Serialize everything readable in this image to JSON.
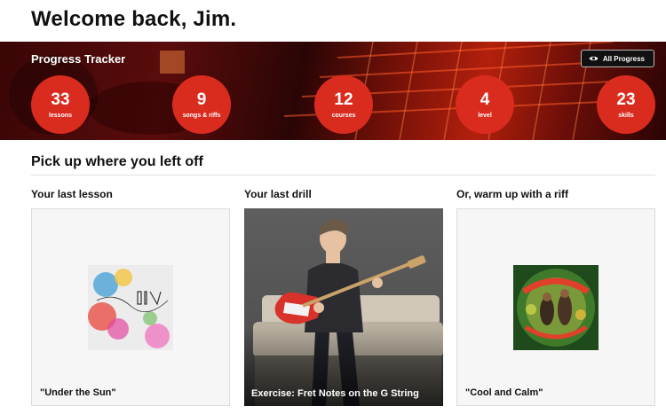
{
  "header": {
    "welcome": "Welcome back, Jim."
  },
  "progress": {
    "title": "Progress Tracker",
    "all_progress_label": "All Progress",
    "stats": [
      {
        "value": "33",
        "label": "lessons"
      },
      {
        "value": "9",
        "label": "songs & riffs"
      },
      {
        "value": "12",
        "label": "courses"
      },
      {
        "value": "4",
        "label": "level"
      },
      {
        "value": "23",
        "label": "skills"
      }
    ]
  },
  "continue": {
    "heading": "Pick up where you left off",
    "columns": [
      {
        "title": "Your last lesson",
        "card_title": "\"Under the Sun\""
      },
      {
        "title": "Your last drill",
        "card_title": "Exercise: Fret Notes on the G String"
      },
      {
        "title": "Or, warm up with a riff",
        "card_title": "\"Cool and Calm\""
      }
    ]
  },
  "colors": {
    "accent": "#d92c1f",
    "banner": "#5a0c0c"
  },
  "icons": {
    "all_progress": "eye-icon"
  }
}
